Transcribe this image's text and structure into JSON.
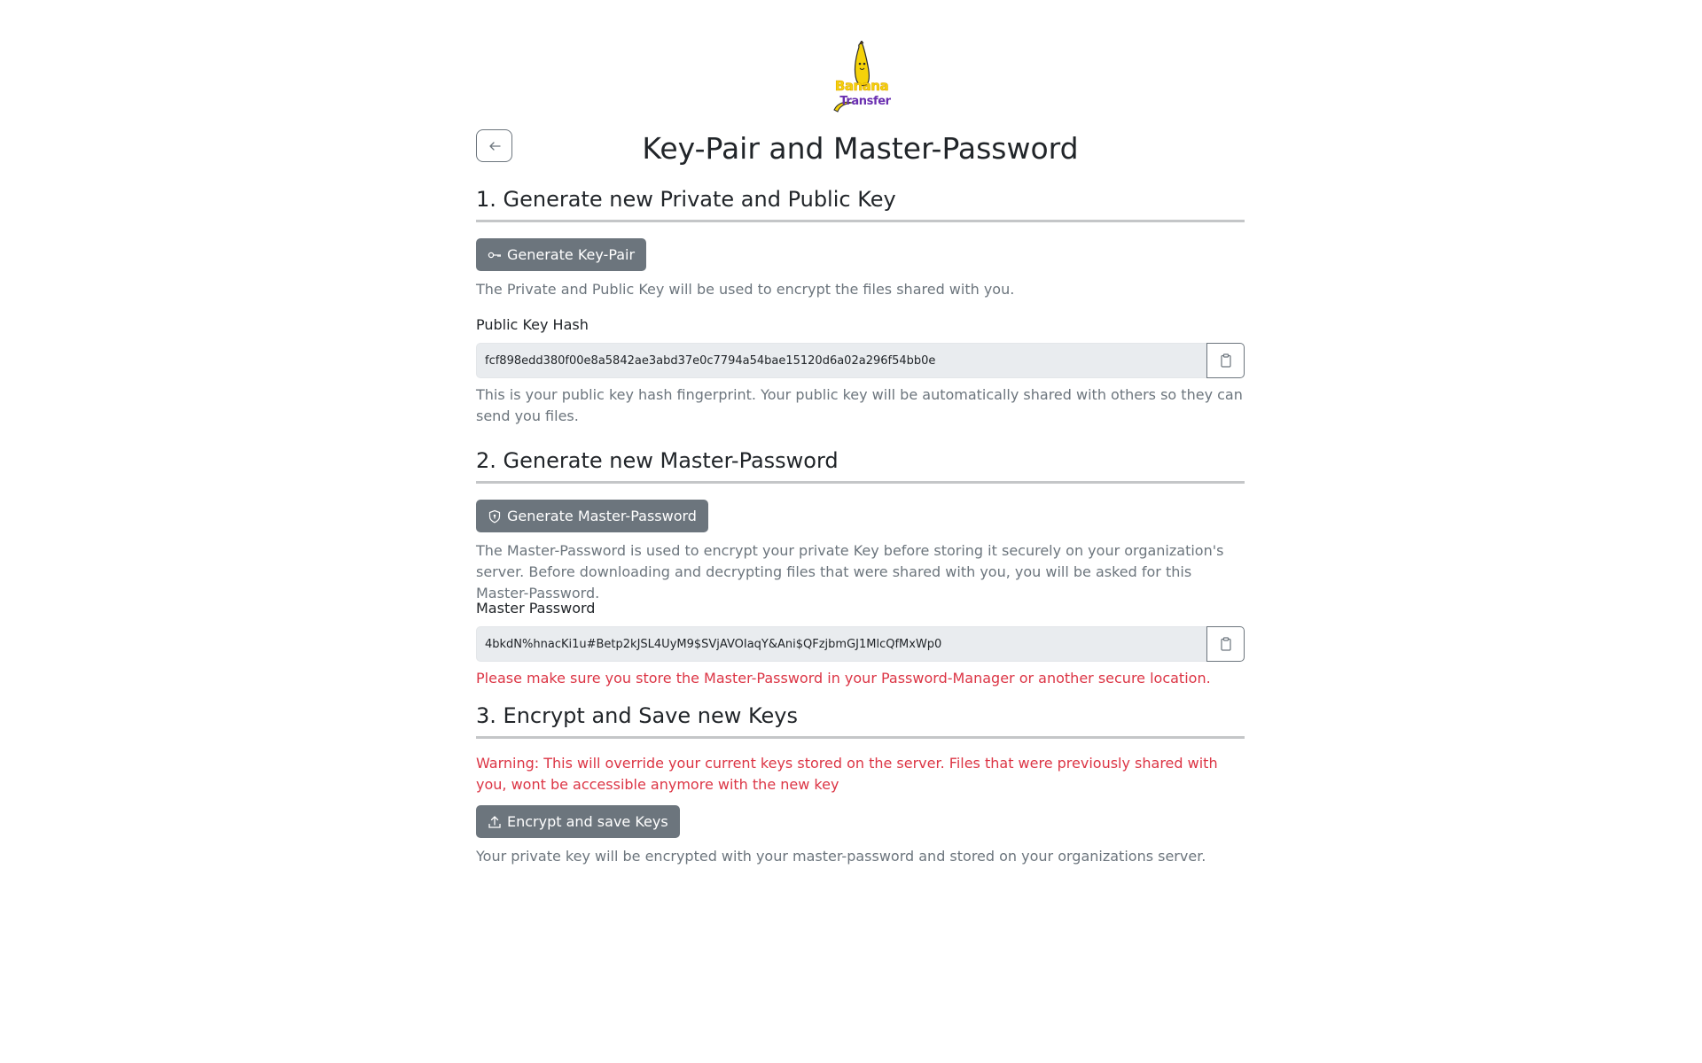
{
  "brand": {
    "word1": "Banana",
    "word2": "Transfer"
  },
  "header": {
    "title": "Key-Pair and Master-Password"
  },
  "section1": {
    "heading": "1. Generate new Private and Public Key",
    "button_label": "Generate Key-Pair",
    "description": "The Private and Public Key will be used to encrypt the files shared with you.",
    "field_label": "Public Key Hash",
    "field_value": "fcf898edd380f00e8a5842ae3abd37e0c7794a54bae15120d6a02a296f54bb0e",
    "help_text": "This is your public key hash fingerprint. Your public key will be automatically shared with others so they can send you files."
  },
  "section2": {
    "heading": "2. Generate new Master-Password",
    "button_label": "Generate Master-Password",
    "description": "The Master-Password is used to encrypt your private Key before storing it securely on your organization's server. Before downloading and decrypting files that were shared with you, you will be asked for this Master-Password.",
    "field_label": "Master Password",
    "field_value": "4bkdN%hnacKi1u#Betp2kJSL4UyM9$SVjAVOIaqY&Ani$QFzjbmGJ1MlcQfMxWp0",
    "warning_text": "Please make sure you store the Master-Password in your Password-Manager or another secure location."
  },
  "section3": {
    "heading": "3. Encrypt and Save new Keys",
    "warning_text": "Warning: This will override your current keys stored on the server. Files that were previously shared with you, wont be accessible anymore with the new key",
    "button_label": "Encrypt and save Keys",
    "description": "Your private key will be encrypted with your master-password and stored on your organizations server."
  },
  "icons": {
    "back": "arrow-left-icon",
    "key": "key-icon",
    "shield": "shield-lock-icon",
    "upload": "upload-icon",
    "clipboard": "clipboard-icon"
  },
  "colors": {
    "secondary": "#6c757d",
    "danger": "#dc3545",
    "input_bg": "#e9ecef",
    "logo_yellow": "#f5d20a",
    "logo_purple": "#6a2fb0"
  }
}
